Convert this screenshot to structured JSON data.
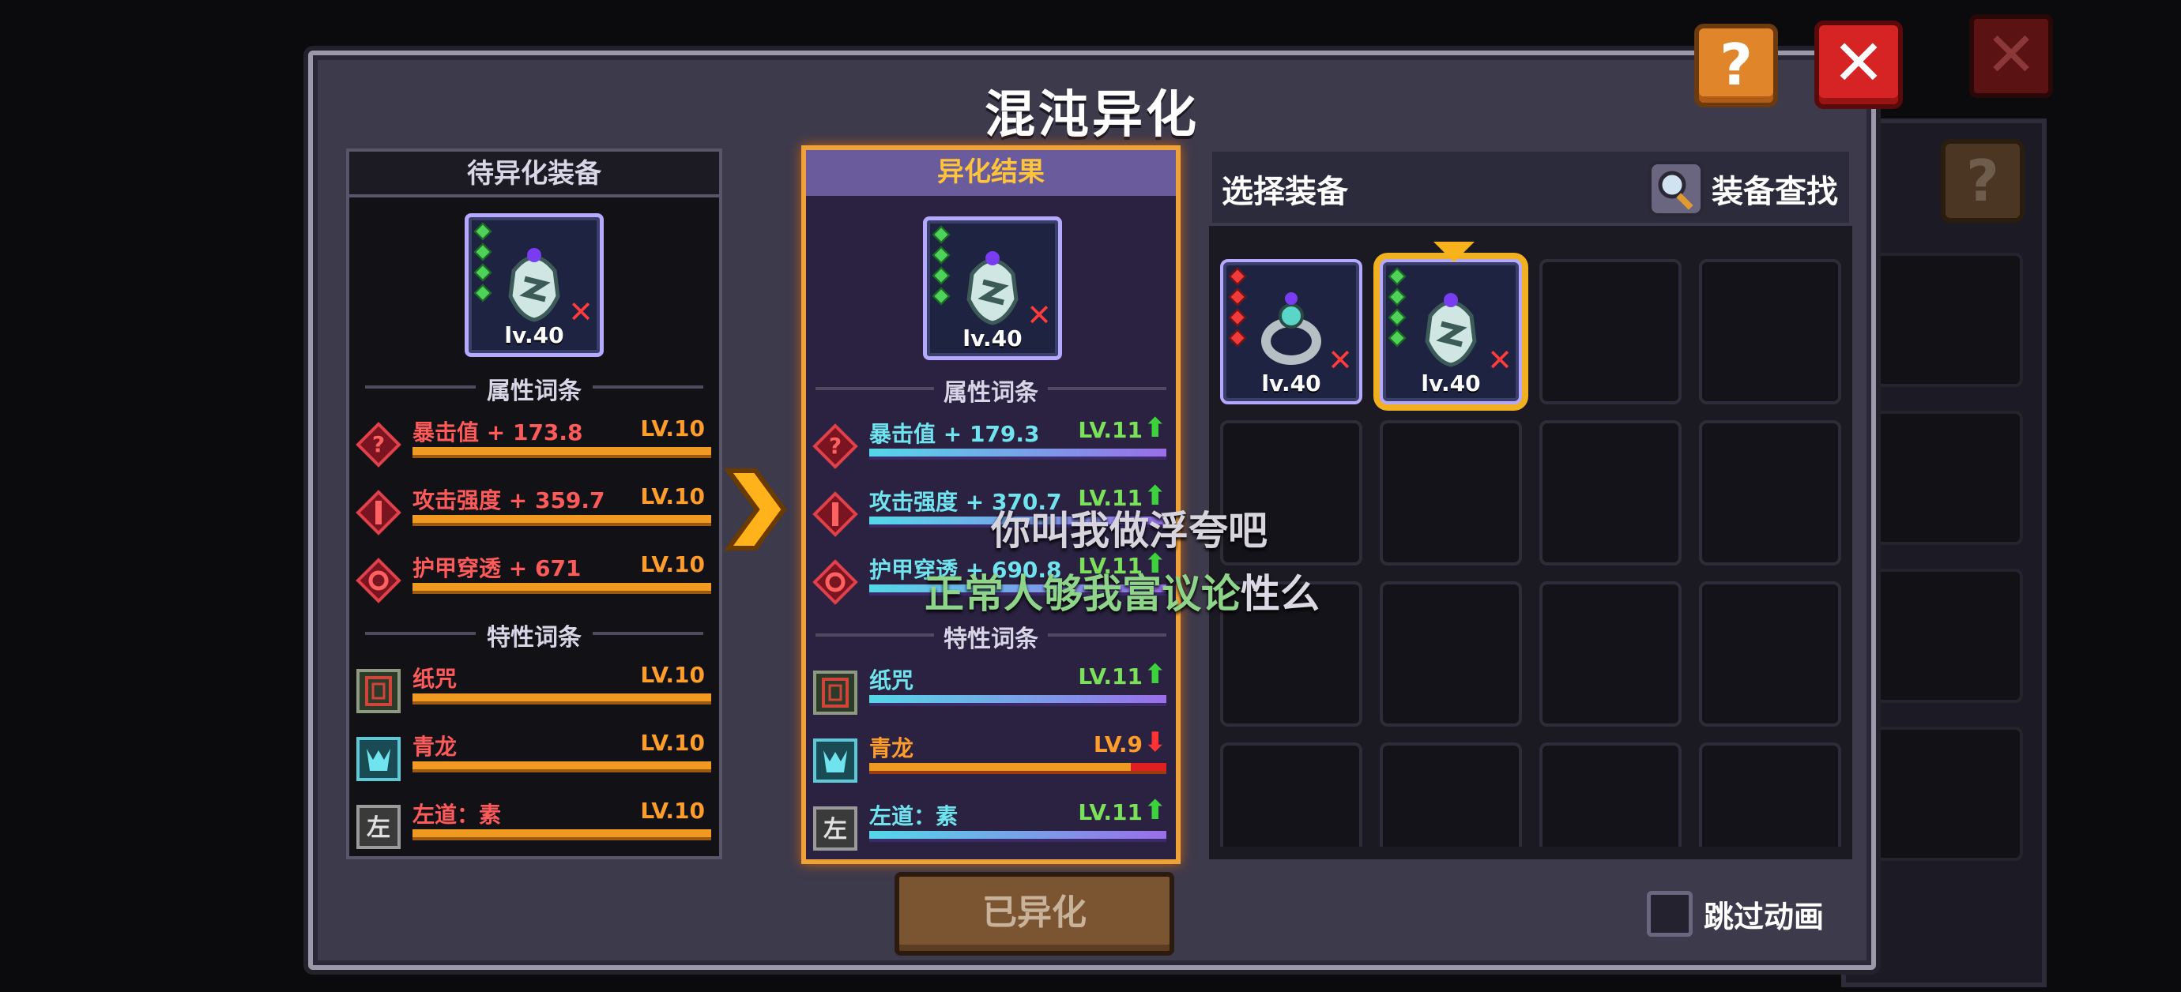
{
  "title": "混沌异化",
  "help_label": "?",
  "close_label": "✕",
  "left_panel": {
    "header": "待异化装备",
    "item_level": "lv.40",
    "attr_section": "属性词条",
    "trait_section": "特性词条",
    "attrs": [
      {
        "name": "暴击值 + 173.8",
        "level": "LV.10"
      },
      {
        "name": "攻击强度 + 359.7",
        "level": "LV.10"
      },
      {
        "name": "护甲穿透 + 671",
        "level": "LV.10"
      }
    ],
    "traits": [
      {
        "name": "纸咒",
        "level": "LV.10"
      },
      {
        "name": "青龙",
        "level": "LV.10"
      },
      {
        "name": "左道：素",
        "level": "LV.10"
      }
    ]
  },
  "middle_panel": {
    "header": "异化结果",
    "item_level": "lv.40",
    "attr_section": "属性词条",
    "trait_section": "特性词条",
    "attrs": [
      {
        "name": "暴击值 + 179.3",
        "level": "LV.11",
        "trend": "up"
      },
      {
        "name": "攻击强度 + 370.7",
        "level": "LV.11",
        "trend": "up"
      },
      {
        "name": "护甲穿透 + 690.8",
        "level": "LV.11",
        "trend": "up"
      }
    ],
    "traits": [
      {
        "name": "纸咒",
        "level": "LV.11",
        "trend": "up"
      },
      {
        "name": "青龙",
        "level": "LV.9",
        "trend": "down"
      },
      {
        "name": "左道：素",
        "level": "LV.11",
        "trend": "up"
      }
    ]
  },
  "right_panel": {
    "header": "选择装备",
    "search_label": "装备查找",
    "items": [
      {
        "level": "lv.40"
      },
      {
        "level": "lv.40"
      }
    ]
  },
  "action_button": "已异化",
  "skip_animation": "跳过动画",
  "subtitle_line1": "你叫我做浮夸吧",
  "subtitle_line2_green": "正常人够我富议论",
  "subtitle_line2_white": "性么",
  "icons": {
    "arrow": "chevron-right-icon",
    "up": "arrow-up-icon",
    "down": "arrow-down-icon"
  },
  "colors": {
    "accent": "#f0a23a",
    "bar_orange": "#f09a22",
    "up_green": "#3dd23d",
    "down_red": "#ff3333"
  }
}
